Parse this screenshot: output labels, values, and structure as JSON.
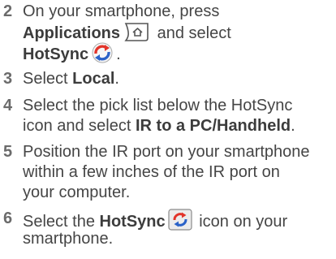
{
  "steps": [
    {
      "number": "2",
      "lines": [
        {
          "pre": "On your smartphone, press"
        },
        {
          "bold": "Applications",
          "icon": "home-applications-icon",
          "post": " and select"
        },
        {
          "bold": "HotSync",
          "icon": "hotsync-icon",
          "post": "."
        }
      ]
    },
    {
      "number": "3",
      "lines": [
        {
          "pre": "Select ",
          "bold": "Local",
          "post": "."
        }
      ]
    },
    {
      "number": "4",
      "lines": [
        {
          "pre": "Select the pick list below the HotSync"
        },
        {
          "pre": "icon and select ",
          "bold": "IR to a PC/Handheld",
          "post": "."
        }
      ]
    },
    {
      "number": "5",
      "lines": [
        {
          "pre": "Position the IR port on your smartphone"
        },
        {
          "pre": "within a few inches of the IR port on"
        },
        {
          "pre": "your computer."
        }
      ]
    },
    {
      "number": "6",
      "lines": [
        {
          "pre": "Select the ",
          "bold": "HotSync",
          "icon": "hotsync-button-icon",
          "post": " icon on your"
        },
        {
          "pre": "smartphone."
        }
      ]
    }
  ]
}
